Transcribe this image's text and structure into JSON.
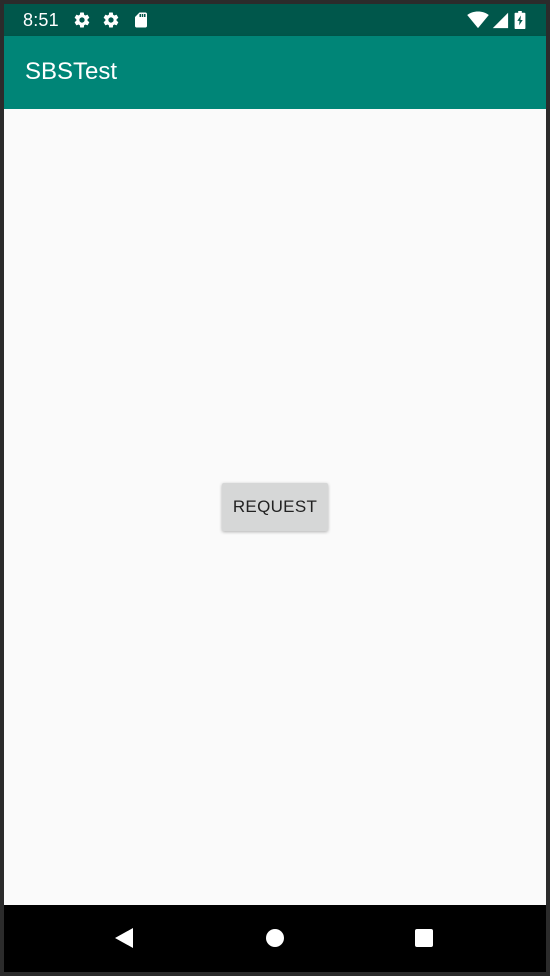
{
  "status_bar": {
    "time": "8:51",
    "icons": [
      "gear-icon",
      "gear-icon",
      "sd-card-icon",
      "wifi-icon",
      "cell-signal-icon",
      "battery-charging-icon"
    ],
    "background": "#00574b"
  },
  "app_bar": {
    "title": "SBSTest",
    "background": "#008577"
  },
  "main": {
    "request_button_label": "REQUEST",
    "button_background": "#d6d7d7"
  },
  "nav_bar": {
    "icons": [
      "back-icon",
      "home-icon",
      "recents-icon"
    ],
    "background": "#000000"
  }
}
